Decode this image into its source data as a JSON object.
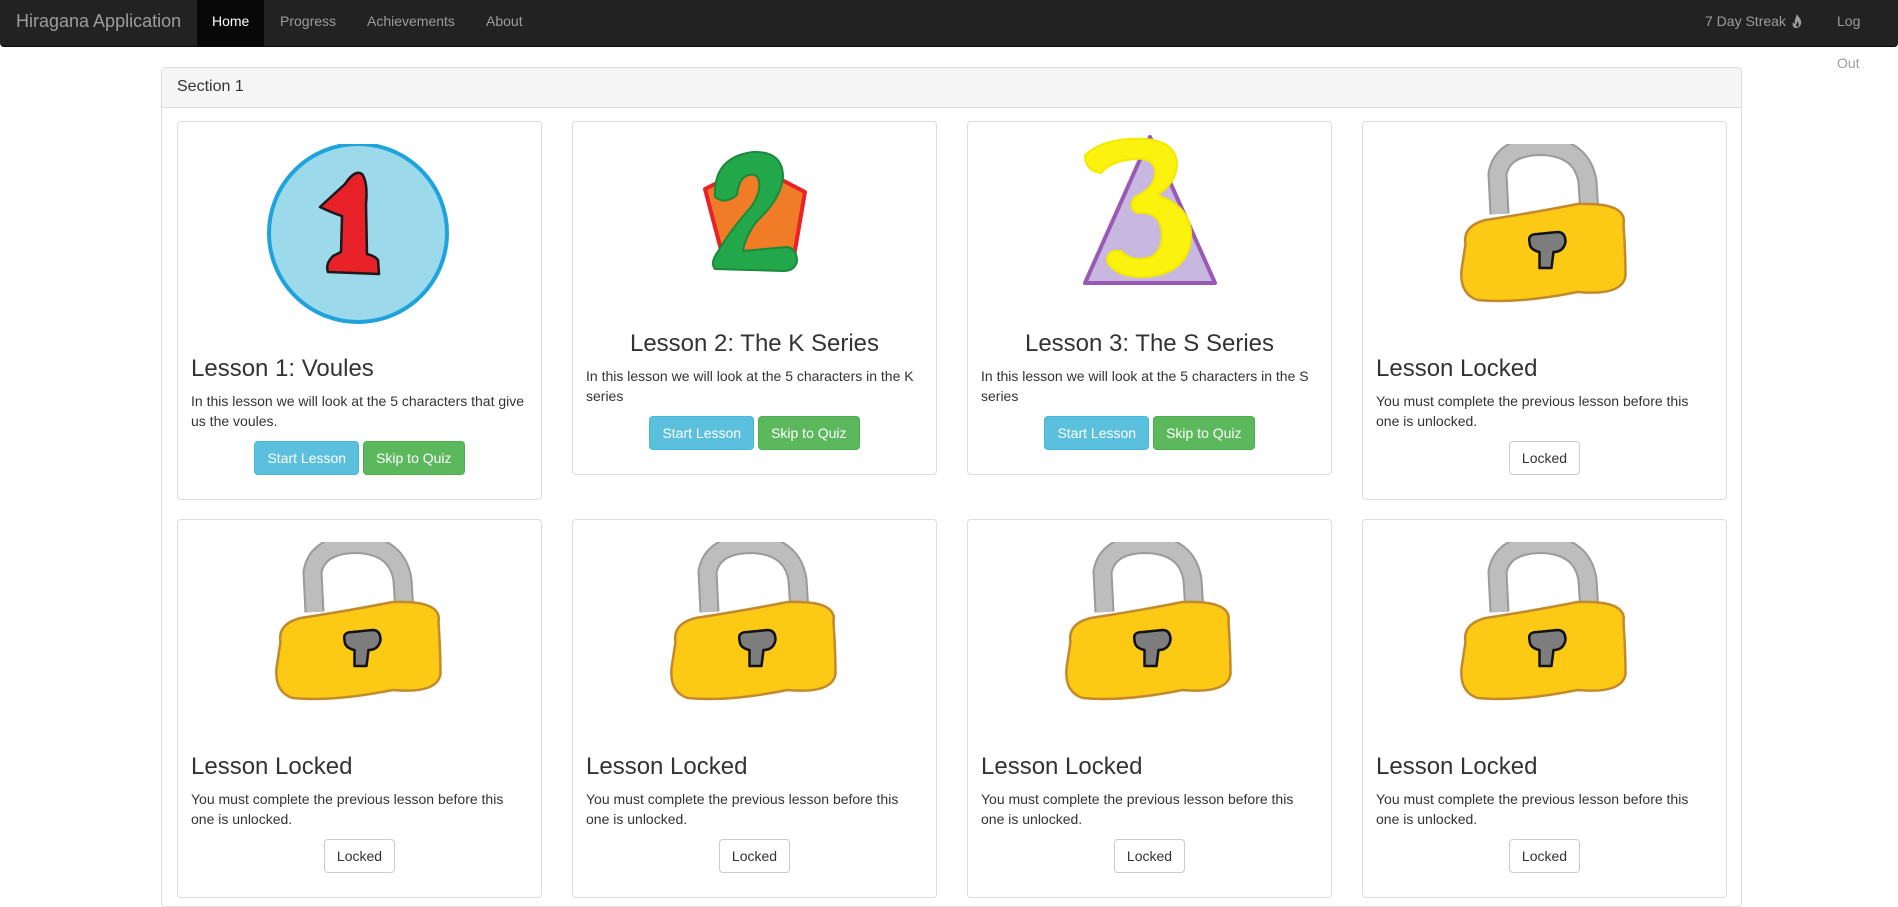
{
  "navbar": {
    "brand": "Hiragana Application",
    "links": [
      {
        "label": "Home",
        "active": true
      },
      {
        "label": "Progress",
        "active": false
      },
      {
        "label": "Achievements",
        "active": false
      },
      {
        "label": "About",
        "active": false
      }
    ],
    "streak": "7 Day Streak",
    "logout": "Log Out"
  },
  "section": {
    "title": "Section 1"
  },
  "lessons": [
    {
      "title": "Lesson 1: Voules",
      "description": "In this lesson we will look at the 5 characters that give us the voules.",
      "start_label": "Start Lesson",
      "quiz_label": "Skip to Quiz",
      "icon": "number-1-circle"
    },
    {
      "title": "Lesson 2: The K Series",
      "description": "In this lesson we will look at the 5 characters in the K series",
      "start_label": "Start Lesson",
      "quiz_label": "Skip to Quiz",
      "icon": "number-2-pentagon"
    },
    {
      "title": "Lesson 3: The S Series",
      "description": "In this lesson we will look at the 5 characters in the S series",
      "start_label": "Start Lesson",
      "quiz_label": "Skip to Quiz",
      "icon": "number-3-triangle"
    },
    {
      "title": "Lesson Locked",
      "description": "You must complete the previous lesson before this one is unlocked.",
      "locked_label": "Locked",
      "icon": "padlock"
    },
    {
      "title": "Lesson Locked",
      "description": "You must complete the previous lesson before this one is unlocked.",
      "locked_label": "Locked",
      "icon": "padlock"
    },
    {
      "title": "Lesson Locked",
      "description": "You must complete the previous lesson before this one is unlocked.",
      "locked_label": "Locked",
      "icon": "padlock"
    },
    {
      "title": "Lesson Locked",
      "description": "You must complete the previous lesson before this one is unlocked.",
      "locked_label": "Locked",
      "icon": "padlock"
    },
    {
      "title": "Lesson Locked",
      "description": "You must complete the previous lesson before this one is unlocked.",
      "locked_label": "Locked",
      "icon": "padlock"
    }
  ],
  "colors": {
    "navbar_bg": "#222222",
    "start_button": "#5bc0de",
    "quiz_button": "#5cb85c",
    "lock_body": "#fcc914",
    "lock_shackle": "#b4b4b4"
  }
}
